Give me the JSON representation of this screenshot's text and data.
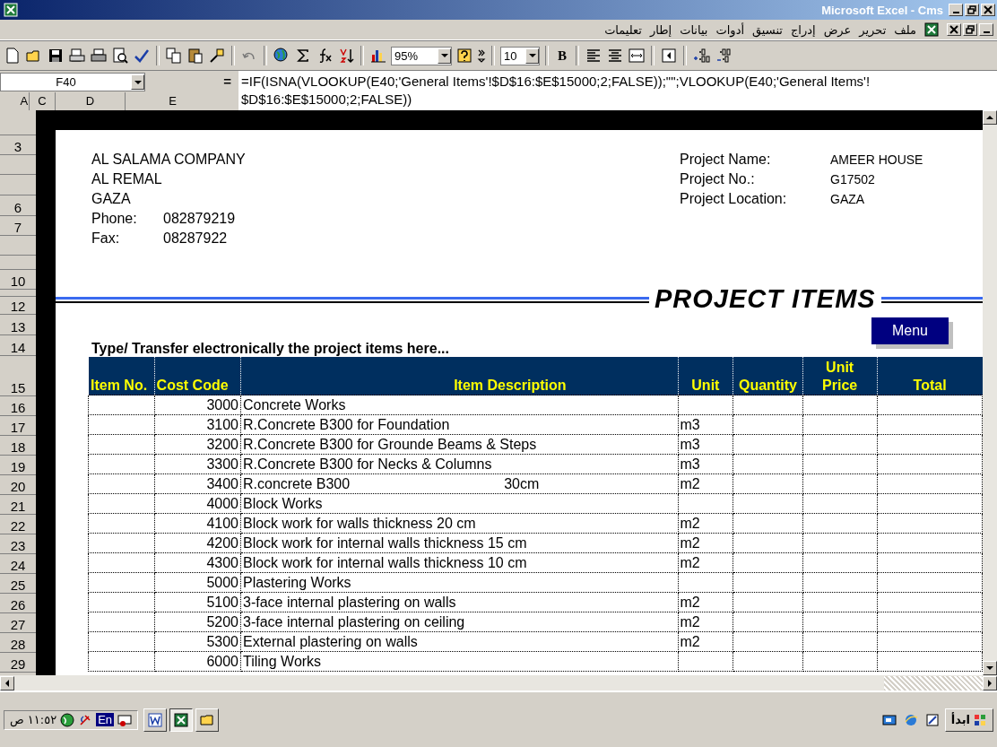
{
  "window": {
    "title": "Microsoft Excel - Cms"
  },
  "menu": [
    "ملف",
    "تحرير",
    "عرض",
    "إدراج",
    "تنسيق",
    "أدوات",
    "بيانات",
    "إطار",
    "تعليمات"
  ],
  "toolbar": {
    "zoom": "95%",
    "font_size": "10",
    "bold_label": "B"
  },
  "formula_bar": {
    "name_box": "F40",
    "equals": "=",
    "formula_lines": [
      "=IF(ISNA(VLOOKUP(E40;'General Items'!$D$16:$E$15000;2;FALSE));\"\";VLOOKUP(E40;'General Items'!",
      "$D$16:$E$15000;2;FALSE))"
    ]
  },
  "column_headers": [
    "A",
    "C",
    "D",
    "E"
  ],
  "row_headers": [
    "3",
    "6",
    "7",
    "10",
    "12",
    "13",
    "14",
    "15",
    "16",
    "17",
    "18",
    "19",
    "20",
    "21",
    "22",
    "23",
    "24",
    "25",
    "26",
    "27",
    "28",
    "29"
  ],
  "company": {
    "lines": [
      "AL SALAMA COMPANY",
      "AL REMAL",
      "GAZA"
    ],
    "contacts": [
      {
        "label": "Phone:",
        "value": "082879219"
      },
      {
        "label": "Fax:",
        "value": "08287922"
      }
    ]
  },
  "project": [
    {
      "label": "Project Name:",
      "value": "AMEER HOUSE"
    },
    {
      "label": "Project No.:",
      "value": "G17502"
    },
    {
      "label": "Project Location:",
      "value": "GAZA"
    }
  ],
  "section_title": "PROJECT ITEMS",
  "menu_button": "Menu",
  "instruction": "Type/ Transfer electronically the project items here...",
  "table": {
    "columns": [
      [
        "Item No."
      ],
      [
        "Cost Code"
      ],
      [
        "Item Description"
      ],
      [
        "Unit"
      ],
      [
        "Quantity"
      ],
      [
        "Unit",
        "Price"
      ],
      [
        "Total"
      ]
    ],
    "rows": [
      {
        "code": "3000",
        "description": "Concrete Works"
      },
      {
        "code": "3100",
        "description": "R.Concrete B300 for Foundation",
        "unit": "m3"
      },
      {
        "code": "3200",
        "description": "R.Concrete B300 for Grounde Beams & Steps",
        "unit": "m3"
      },
      {
        "code": "3300",
        "description": "R.Concrete B300 for Necks & Columns",
        "unit": "m3"
      },
      {
        "code": "3400",
        "description": "R.concrete B300",
        "note": "30cm",
        "unit": "m2"
      },
      {
        "code": "4000",
        "description": "Block Works"
      },
      {
        "code": "4100",
        "description": "Block work for walls thickness 20 cm",
        "unit": "m2"
      },
      {
        "code": "4200",
        "description": "Block work for internal walls thickness 15 cm",
        "unit": "m2"
      },
      {
        "code": "4300",
        "description": "Block work for internal walls thickness 10 cm",
        "unit": "m2"
      },
      {
        "code": "5000",
        "description": "Plastering Works"
      },
      {
        "code": "5100",
        "description": "3-face internal plastering on walls",
        "unit": "m2"
      },
      {
        "code": "5200",
        "description": "3-face internal plastering on ceiling",
        "unit": "m2"
      },
      {
        "code": "5300",
        "description": "External plastering on walls",
        "unit": "m2"
      },
      {
        "code": "6000",
        "description": "Tiling Works"
      }
    ]
  },
  "taskbar": {
    "start": "ابدأ",
    "language": "En",
    "clock": "١١:٥٢ ص",
    "tasks": [
      {
        "kind": "word",
        "selected": false
      },
      {
        "kind": "excel",
        "selected": true
      },
      {
        "kind": "folder",
        "selected": false
      }
    ]
  }
}
